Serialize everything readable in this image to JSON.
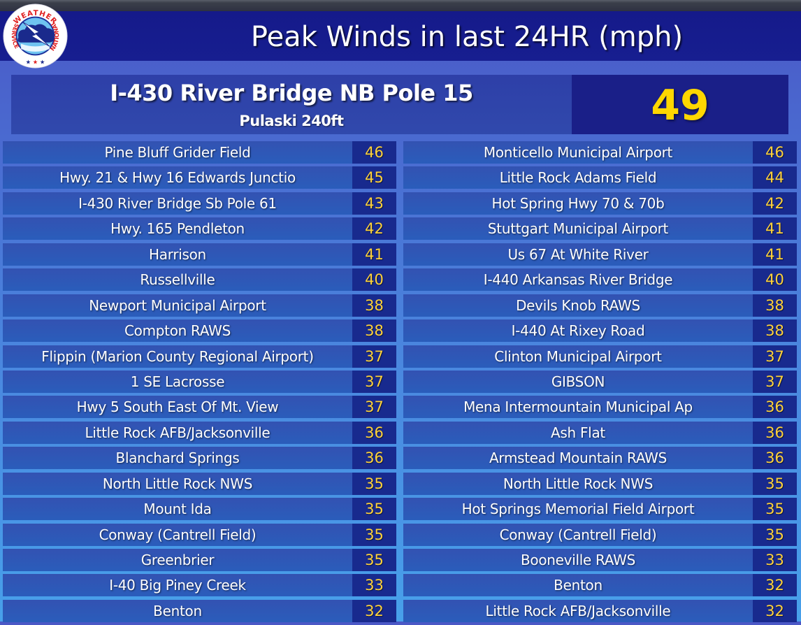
{
  "header": {
    "title": "Peak Winds in last 24HR (mph)",
    "logo_text": "NATIONAL WEATHER SERVICE",
    "logo_icon": "nws-logo-icon"
  },
  "feature": {
    "station": "I-430 River Bridge NB Pole 15",
    "subtitle": "Pulaski 240ft",
    "value": "49",
    "value_color": "#ffd700"
  },
  "colors": {
    "header_bg": "#151a8a",
    "row_bg": "#2f56b6",
    "value_bg": "#182a8e",
    "value_text": "#ffd23a"
  },
  "left_column": [
    {
      "name": "Pine Bluff Grider Field",
      "value": "46"
    },
    {
      "name": "Hwy. 21 & Hwy 16 Edwards Junctio",
      "value": "45"
    },
    {
      "name": "I-430 River Bridge Sb Pole 61",
      "value": "43"
    },
    {
      "name": "Hwy. 165 Pendleton",
      "value": "42"
    },
    {
      "name": "Harrison",
      "value": "41"
    },
    {
      "name": "Russellville",
      "value": "40"
    },
    {
      "name": "Newport Municipal Airport",
      "value": "38"
    },
    {
      "name": "Compton RAWS",
      "value": "38"
    },
    {
      "name": "Flippin (Marion County Regional Airport)",
      "value": "37"
    },
    {
      "name": "1 SE Lacrosse",
      "value": "37"
    },
    {
      "name": "Hwy 5 South East Of Mt. View",
      "value": "37"
    },
    {
      "name": "Little Rock AFB/Jacksonville",
      "value": "36"
    },
    {
      "name": "Blanchard Springs",
      "value": "36"
    },
    {
      "name": "North Little Rock NWS",
      "value": "35"
    },
    {
      "name": "Mount Ida",
      "value": "35"
    },
    {
      "name": "Conway (Cantrell Field)",
      "value": "35"
    },
    {
      "name": "Greenbrier",
      "value": "35"
    },
    {
      "name": "I-40 Big Piney Creek",
      "value": "33"
    },
    {
      "name": "Benton",
      "value": "32"
    }
  ],
  "right_column": [
    {
      "name": "Monticello Municipal Airport",
      "value": "46"
    },
    {
      "name": "Little Rock Adams Field",
      "value": "44"
    },
    {
      "name": "Hot Spring Hwy 70 & 70b",
      "value": "42"
    },
    {
      "name": "Stuttgart Municipal Airport",
      "value": "41"
    },
    {
      "name": "Us 67 At White River",
      "value": "41"
    },
    {
      "name": "I-440 Arkansas River Bridge",
      "value": "40"
    },
    {
      "name": "Devils Knob RAWS",
      "value": "38"
    },
    {
      "name": "I-440 At Rixey Road",
      "value": "38"
    },
    {
      "name": "Clinton Municipal Airport",
      "value": "37"
    },
    {
      "name": "GIBSON",
      "value": "37"
    },
    {
      "name": "Mena Intermountain Municipal Ap",
      "value": "36"
    },
    {
      "name": "Ash Flat",
      "value": "36"
    },
    {
      "name": "Armstead Mountain RAWS",
      "value": "36"
    },
    {
      "name": "North Little Rock NWS",
      "value": "35"
    },
    {
      "name": "Hot Springs Memorial Field Airport",
      "value": "35"
    },
    {
      "name": "Conway (Cantrell Field)",
      "value": "35"
    },
    {
      "name": "Booneville RAWS",
      "value": "33"
    },
    {
      "name": "Benton",
      "value": "32"
    },
    {
      "name": "Little Rock AFB/Jacksonville",
      "value": "32"
    }
  ]
}
